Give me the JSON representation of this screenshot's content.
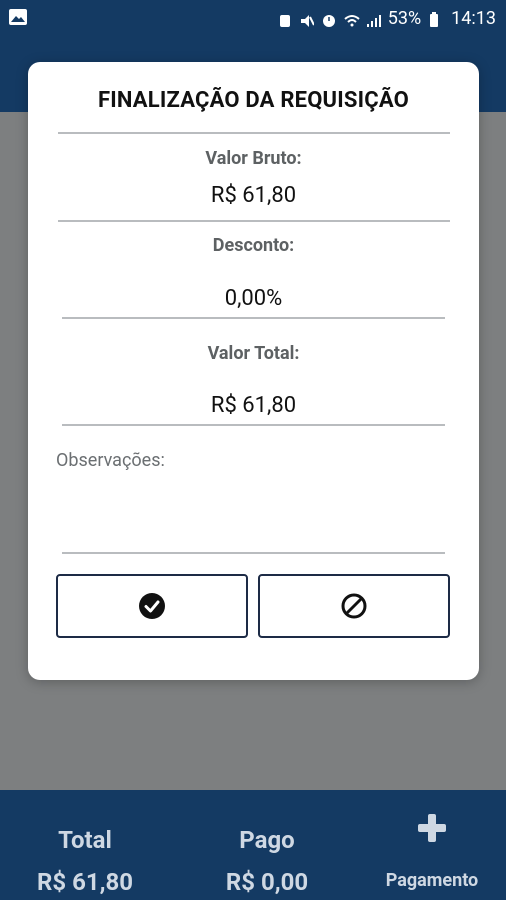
{
  "status_bar": {
    "battery_percent": "53%",
    "time": "14:13"
  },
  "dialog": {
    "title": "FINALIZAÇÃO DA REQUISIÇÃO",
    "valor_bruto_label": "Valor Bruto:",
    "valor_bruto_value": "R$ 61,80",
    "desconto_label": "Desconto:",
    "desconto_value": "0,00%",
    "valor_total_label": "Valor Total:",
    "valor_total_value": "R$ 61,80",
    "observacoes_placeholder": "Observações:",
    "confirm_icon": "check-circle-icon",
    "cancel_icon": "ban-icon"
  },
  "bottom_bar": {
    "total_label": "Total",
    "total_value": "R$ 61,80",
    "pago_label": "Pago",
    "pago_value": "R$ 0,00",
    "pagamento_label": "Pagamento",
    "add_icon": "plus-icon"
  },
  "colors": {
    "primary": "#143a63",
    "overlay": "#7d7f80",
    "button_border": "#1d2b46"
  }
}
